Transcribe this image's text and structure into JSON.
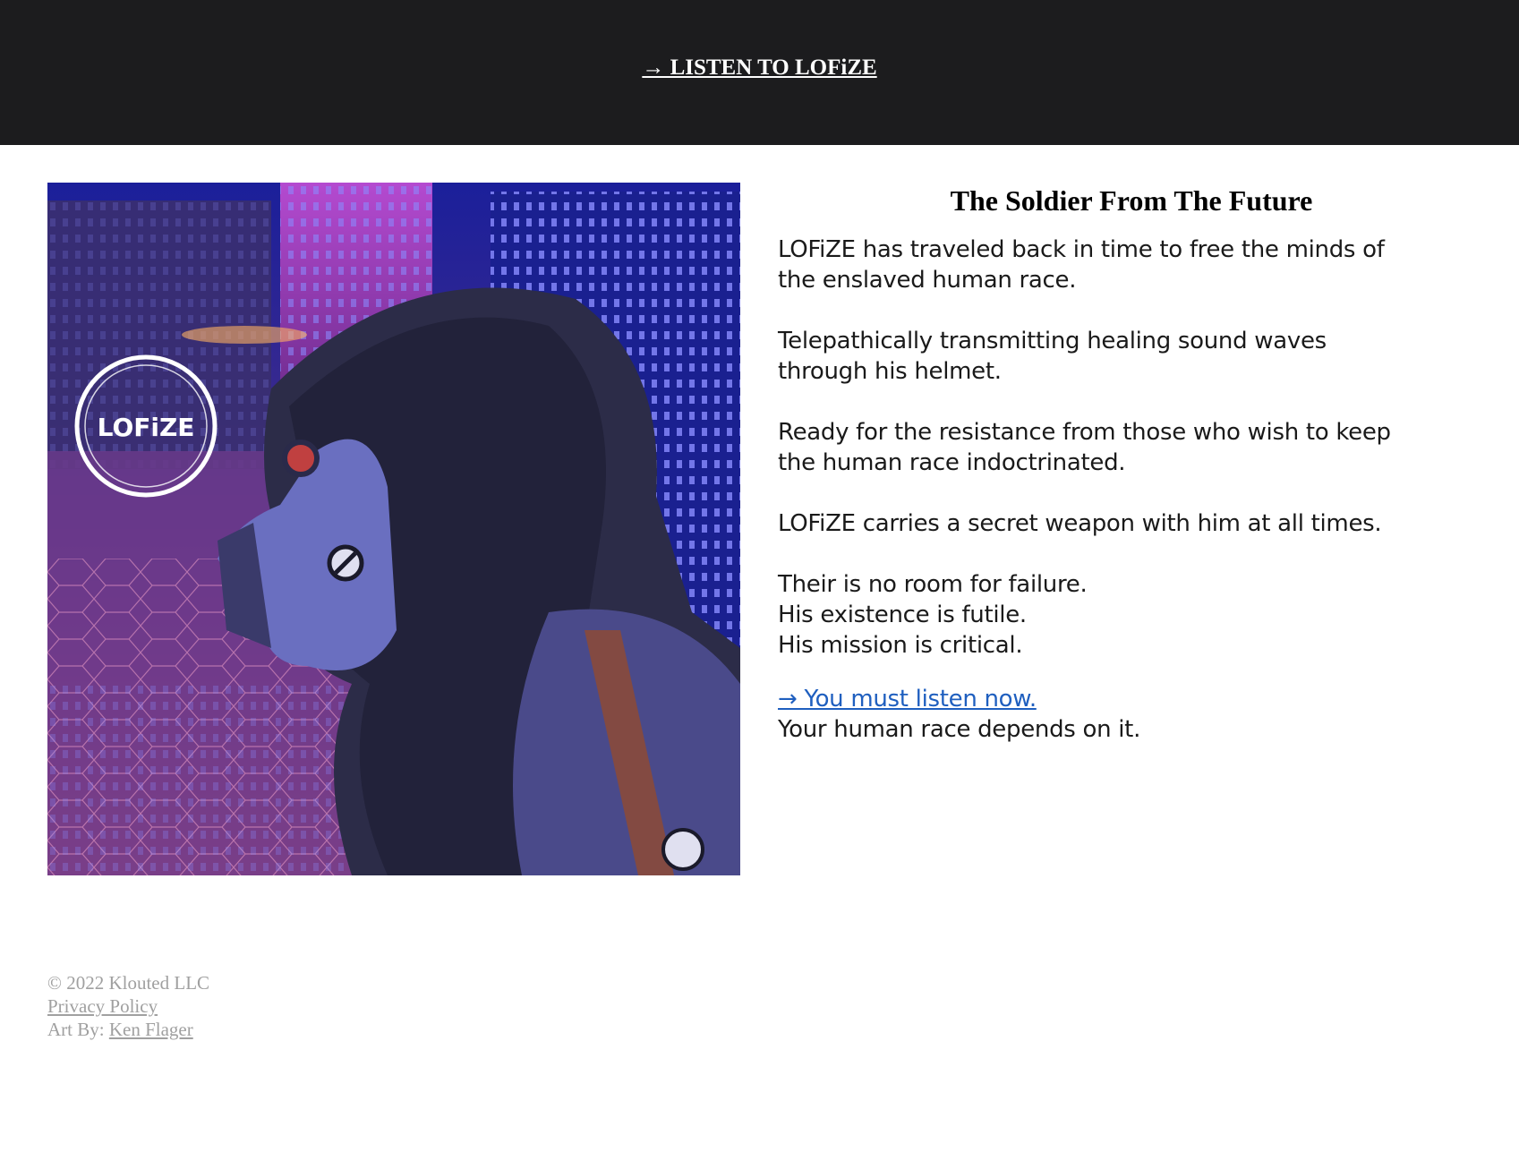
{
  "header": {
    "listen_link": "→ LISTEN TO LOFiZE"
  },
  "artwork": {
    "logo_text": "LOFiZE",
    "colors": {
      "sky": "#2a1a8a",
      "pink": "#c0508a",
      "hood": "#2c2c48",
      "mask": "#6a6fc0"
    }
  },
  "article": {
    "title": "The Soldier From The Future",
    "paragraphs": [
      [
        "LOFiZE has traveled back in time to free the minds of",
        "the enslaved human race."
      ],
      [
        "Telepathically transmitting healing sound waves",
        "through his helmet."
      ],
      [
        "Ready for the resistance from those who wish to keep",
        "the human race indoctrinated."
      ],
      [
        "LOFiZE carries a secret weapon with him at all times."
      ],
      [
        "Their is no room for failure.",
        "His existence is futile.",
        "His mission is critical."
      ]
    ],
    "cta_link": "→ You must listen now.",
    "cta_sub": "Your human race depends on it."
  },
  "footer": {
    "copyright": "© 2022 Klouted LLC",
    "privacy": "Privacy Policy",
    "art_by_label": "Art By: ",
    "artist": "Ken Flager"
  }
}
